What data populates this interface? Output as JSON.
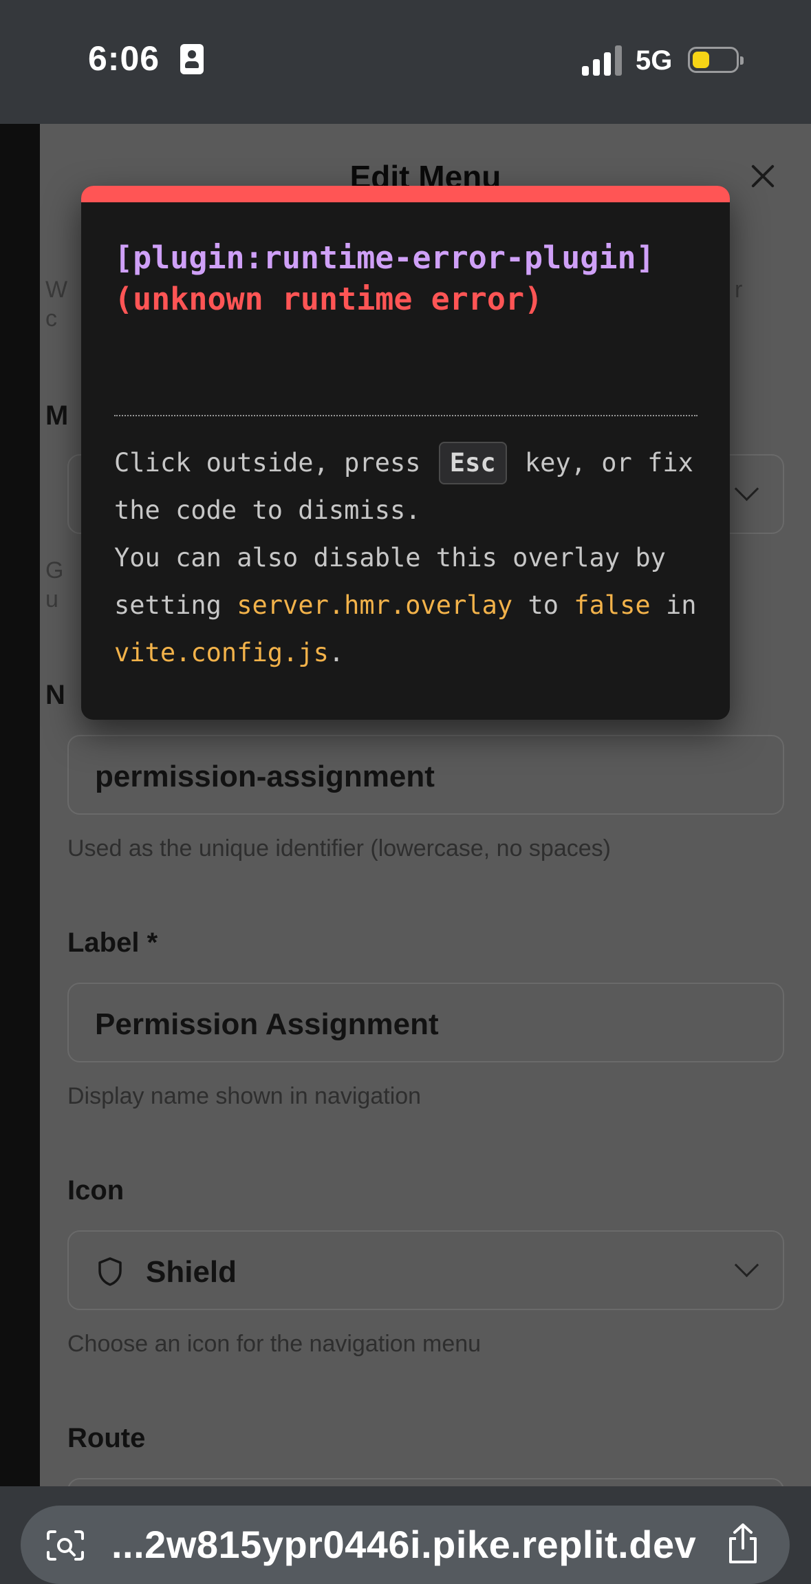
{
  "status_bar": {
    "time": "6:06",
    "network": "5G",
    "battery_level": 0.4,
    "battery_color": "#f6d416"
  },
  "dialog": {
    "title": "Edit Menu",
    "peek_text": {
      "left_w": "W",
      "left_c": "c",
      "right_r": "r",
      "left_m": "M",
      "left_g": "G",
      "left_u": "u",
      "left_n": "N"
    },
    "name_field": {
      "value": "permission-assignment",
      "help": "Used as the unique identifier (lowercase, no spaces)"
    },
    "label_field": {
      "label": "Label *",
      "value": "Permission Assignment",
      "help": "Display name shown in navigation"
    },
    "icon_field": {
      "label": "Icon",
      "value": "Shield",
      "icon": "shield-icon",
      "help": "Choose an icon for the navigation menu"
    },
    "route_field": {
      "label": "Route"
    }
  },
  "error_overlay": {
    "accent_color": "#ff5555",
    "plugin": "[plugin:runtime-error-plugin]",
    "message": "(unknown runtime error)",
    "tip_part1": "Click outside, press ",
    "tip_key": "Esc",
    "tip_part2": " key, or fix the code to dismiss.",
    "tip_part3": "You can also disable this overlay by setting ",
    "tip_code1": "server.hmr.overlay",
    "tip_part4": " to ",
    "tip_code2": "false",
    "tip_part5": " in ",
    "tip_code3": "vite.config.js",
    "tip_part6": "."
  },
  "browser": {
    "url": "...2w815ypr0446i.pike.replit.dev",
    "icons": [
      "camera-search-icon",
      "share-icon"
    ]
  }
}
